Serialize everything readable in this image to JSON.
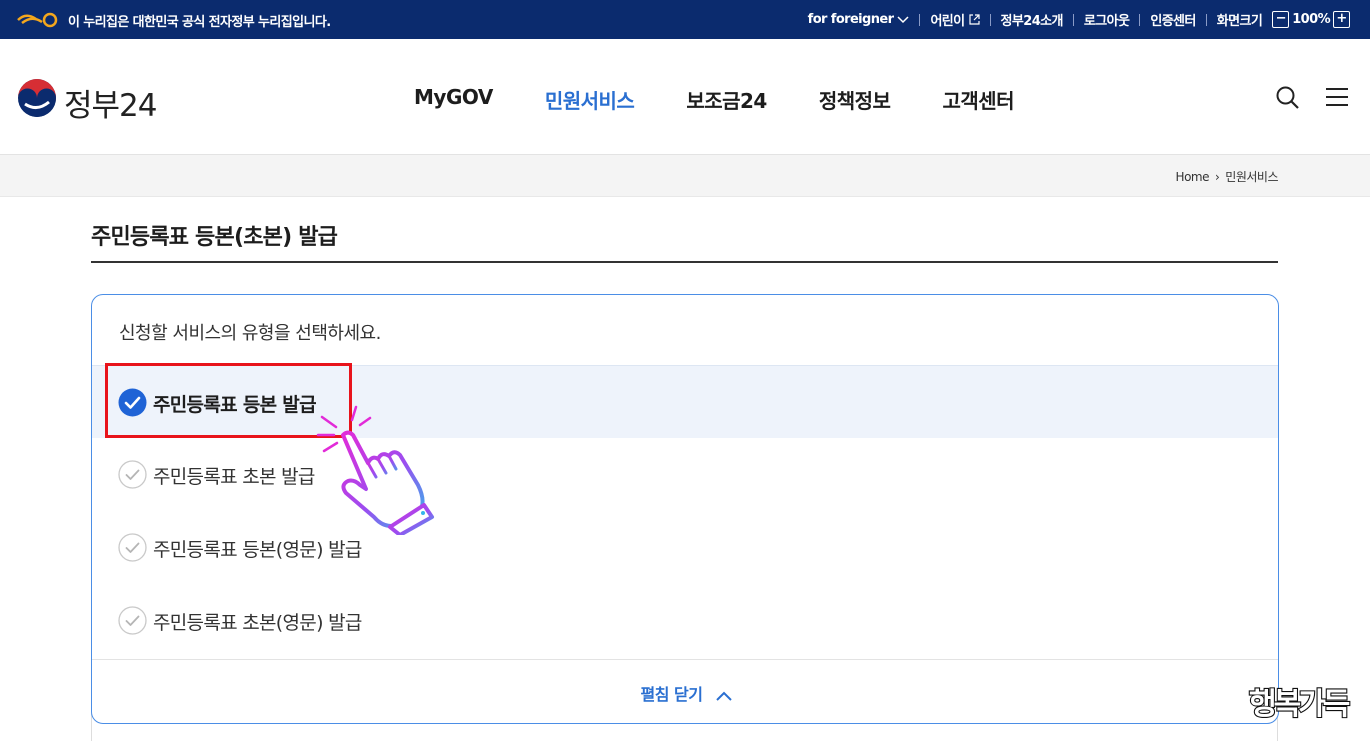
{
  "topbar": {
    "notice": "이 누리집은 대한민국 공식 전자정부 누리집입니다.",
    "links": [
      "for foreigner",
      "어린이",
      "정부24소개",
      "로그아웃",
      "인증센터",
      "화면크기"
    ],
    "zoom_minus": "−",
    "zoom_level": "100%",
    "zoom_plus": "+"
  },
  "header": {
    "brand": "정부24",
    "nav": [
      "MyGOV",
      "민원서비스",
      "보조금24",
      "정책정보",
      "고객센터"
    ],
    "active_nav": "민원서비스"
  },
  "breadcrumb": {
    "home": "Home",
    "separator": "›",
    "current": "민원서비스"
  },
  "page": {
    "title": "주민등록표 등본(초본) 발급"
  },
  "service_panel": {
    "prompt": "신청할 서비스의 유형을 선택하세요.",
    "options": [
      {
        "label": "주민등록표 등본 발급",
        "selected": true
      },
      {
        "label": "주민등록표 초본 발급",
        "selected": false
      },
      {
        "label": "주민등록표 등본(영문) 발급",
        "selected": false
      },
      {
        "label": "주민등록표 초본(영문) 발급",
        "selected": false
      }
    ],
    "toggle_label": "펼침 닫기"
  },
  "colors": {
    "topbar_bg": "#0b2b6e",
    "accent": "#2a6fd1",
    "highlight_box": "#e8131b",
    "selected_row_bg": "#eef3fb"
  },
  "watermark": "행복가득"
}
